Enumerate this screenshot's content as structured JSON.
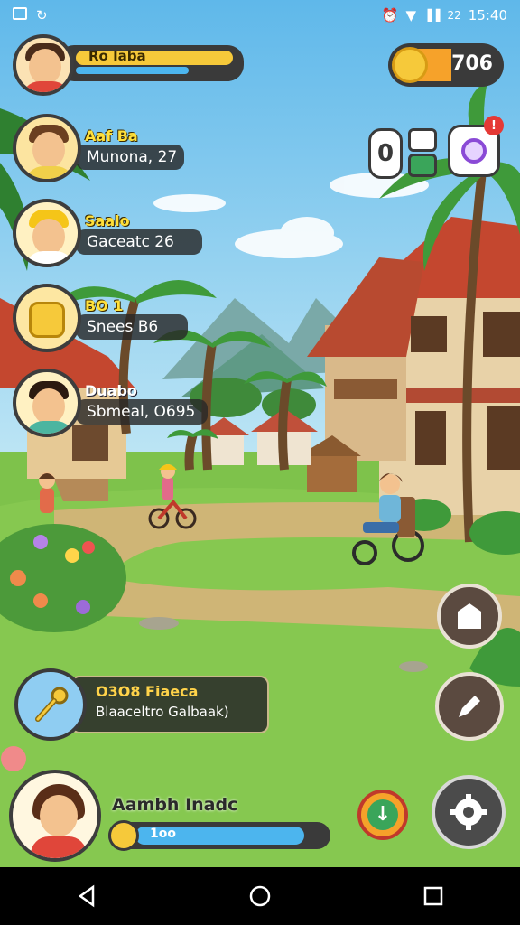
{
  "status_bar": {
    "time": "15:40",
    "signal_label": "22"
  },
  "player": {
    "name": "Ro Iaba",
    "xp_progress": 0.72
  },
  "coins": {
    "value": "706"
  },
  "friends": [
    {
      "tag": "Aaf Ba",
      "info": "Munona, 27"
    },
    {
      "tag": "Saalo",
      "info": "Gaceatc 26"
    },
    {
      "tag": "BO 1",
      "info": "Snees B6"
    },
    {
      "tag": "Duabo",
      "info": "Sbmeal, O695"
    }
  ],
  "top_right": {
    "counter_label": "0",
    "notification_count": "!"
  },
  "quest": {
    "line1": "O3O8 Fiaeca",
    "line2": "Blaaceltro Galbaak)"
  },
  "bottom_player": {
    "name": "Aambh Inadc",
    "bar_label": "1oo",
    "bar_progress": 0.9
  },
  "colors": {
    "sky": "#6fc1ea",
    "grass": "#7ec24b",
    "hud_dark": "#3a3a3a",
    "xp_yellow": "#f6c93a",
    "xp_blue": "#4cb5ee"
  },
  "icons": [
    "home-icon",
    "pencil-icon",
    "settings-icon",
    "check-icon",
    "coin-icon"
  ]
}
